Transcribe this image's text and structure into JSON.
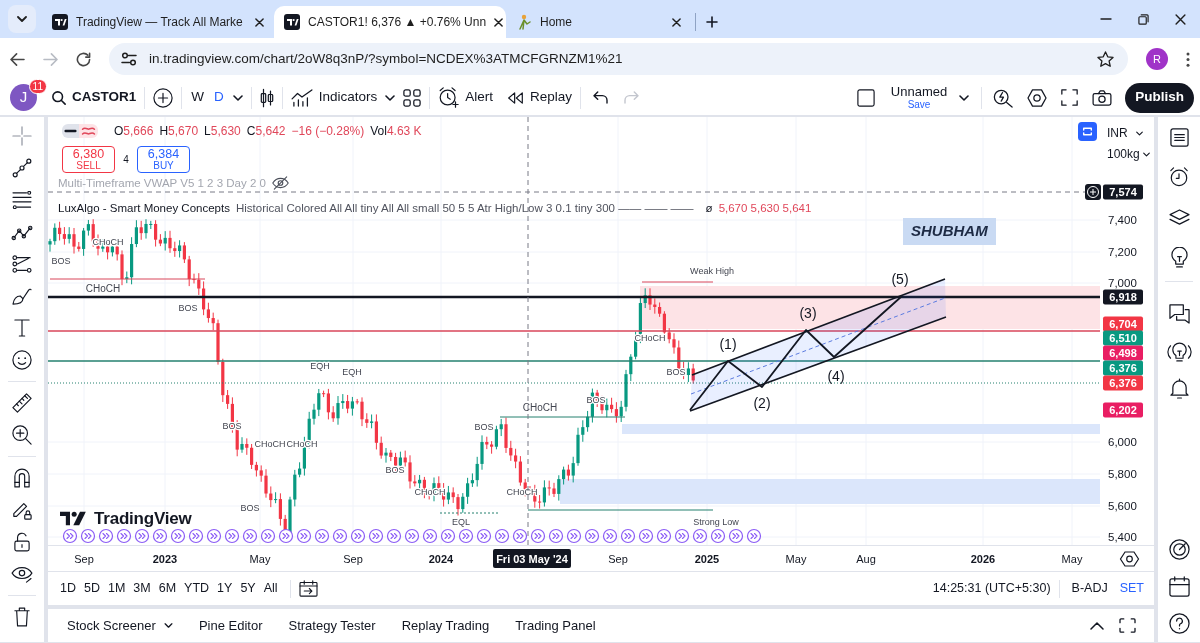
{
  "browser": {
    "tabs": [
      {
        "title": "TradingView — Track All Marke",
        "selected": false
      },
      {
        "title": "CASTOR1! 6,376 ▲ +0.76% Unn",
        "selected": true
      },
      {
        "title": "Home",
        "selected": false
      }
    ],
    "url": "in.tradingview.com/chart/2oW8q3nP/?symbol=NCDEX%3ATMCFGRNZM1%21",
    "forward_disabled": true,
    "profile_initial": "R"
  },
  "header": {
    "avatar_initial": "J",
    "notification_count": "11",
    "symbol": "CASTOR1",
    "intervals": [
      {
        "label": "W",
        "selected": false
      },
      {
        "label": "D",
        "selected": true
      }
    ],
    "indicators": "Indicators",
    "alert": "Alert",
    "replay": "Replay",
    "redo_disabled": true,
    "layout_name": "Unnamed",
    "save": "Save",
    "publish": "Publish"
  },
  "legend": {
    "ohlc": [
      {
        "label": "O",
        "value": "5,666"
      },
      {
        "label": "H",
        "value": "5,670"
      },
      {
        "label": "L",
        "value": "5,630"
      },
      {
        "label": "C",
        "value": "5,642"
      }
    ],
    "change": "−16 (−0.28%)",
    "volume_label": "Vol",
    "volume": "4.63 K"
  },
  "order": {
    "sell_price": "6,380",
    "sell": "SELL",
    "spread": "4",
    "buy_price": "6,384",
    "buy": "BUY"
  },
  "studies": [
    {
      "title": "Multi-Timeframe VWAP V5 1 2 3 Day 2 0",
      "hidden": true
    },
    {
      "title": "LuxAlgo - Smart Money Concepts",
      "inputs": "Historical Colored All All tiny All All small 50 5 5 Atr High/Low 3 0.1 tiny 300 —— —— ——",
      "values_symbol": "ø",
      "values": "5,670 5,630 5,641",
      "hidden": false
    }
  ],
  "chart": {
    "currency": "INR",
    "unit": "100kg",
    "crosshair_price": "7,574",
    "price_ticks": [
      "7,400",
      "7,200",
      "7,000",
      "6,000",
      "5,800",
      "5,600",
      "5,400"
    ],
    "price_badges": [
      {
        "text": "6,918",
        "color": "#131722"
      },
      {
        "text": "6,704",
        "color": "#f23645"
      },
      {
        "text": "6,510",
        "color": "#089981"
      },
      {
        "text": "6,498",
        "color": "#e91e63"
      },
      {
        "text": "6,376",
        "color": "#089981"
      },
      {
        "text": "6,376",
        "color": "#f23645"
      },
      {
        "text": "6,202",
        "color": "#e91e63"
      }
    ],
    "time_ticks": [
      {
        "label": "Sep",
        "kind": "month"
      },
      {
        "label": "2023",
        "kind": "year"
      },
      {
        "label": "May",
        "kind": "month"
      },
      {
        "label": "Sep",
        "kind": "month"
      },
      {
        "label": "2024",
        "kind": "year"
      },
      {
        "label": "Sep",
        "kind": "month"
      },
      {
        "label": "2025",
        "kind": "year"
      },
      {
        "label": "May",
        "kind": "month"
      },
      {
        "label": "Aug",
        "kind": "month"
      },
      {
        "label": "2026",
        "kind": "year"
      },
      {
        "label": "May",
        "kind": "month"
      }
    ],
    "crosshair_date": "Fri 03 May '24",
    "logo": "TradingView",
    "note": "SHUBHAM",
    "wave_labels": [
      "(1)",
      "(2)",
      "(3)",
      "(4)",
      "(5)"
    ],
    "structure_labels": [
      "CHoCH",
      "BOS",
      "CHoCH",
      "BOS",
      "BOS",
      "CHoCH",
      "BOS",
      "EQH",
      "EQH",
      "CHoCH",
      "BOS",
      "CHoCH",
      "EQL",
      "BOS",
      "CHoCH",
      "CHoCH",
      "BOS",
      "CHoCH",
      "BOS",
      "Weak High",
      "Strong Low"
    ]
  },
  "range_bar": {
    "ranges": [
      "1D",
      "5D",
      "1M",
      "3M",
      "6M",
      "YTD",
      "1Y",
      "5Y",
      "All"
    ],
    "time": "14:25:31 (UTC+5:30)",
    "adjustment": "B-ADJ",
    "session": "SET"
  },
  "bottom_panel": {
    "tabs": [
      "Stock Screener",
      "Pine Editor",
      "Strategy Tester",
      "Replay Trading",
      "Trading Panel"
    ]
  }
}
